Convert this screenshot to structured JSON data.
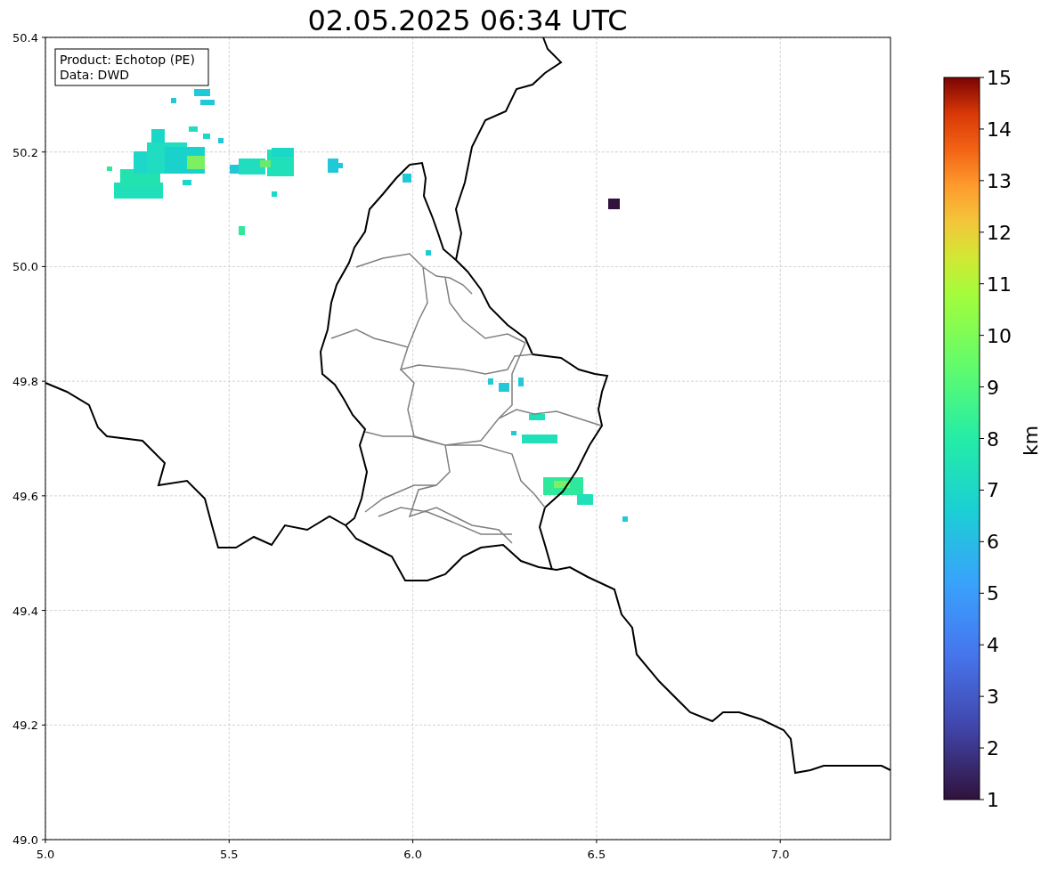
{
  "title": "02.05.2025 06:34 UTC",
  "info_box": {
    "lines": [
      "Product: Echotop (PE)",
      "Data: DWD"
    ]
  },
  "x_axis": {
    "ticks": [
      "5.0",
      "5.5",
      "6.0",
      "6.5",
      "7.0"
    ]
  },
  "y_axis": {
    "ticks": [
      "50.4",
      "50.2",
      "50.0",
      "49.8",
      "49.6",
      "49.4",
      "49.2",
      "49.0"
    ]
  },
  "colorbar": {
    "label": "km",
    "ticks": [
      "15",
      "14",
      "13",
      "12",
      "11",
      "10",
      "9",
      "8",
      "7",
      "6",
      "5",
      "4",
      "3",
      "2",
      "1"
    ]
  }
}
